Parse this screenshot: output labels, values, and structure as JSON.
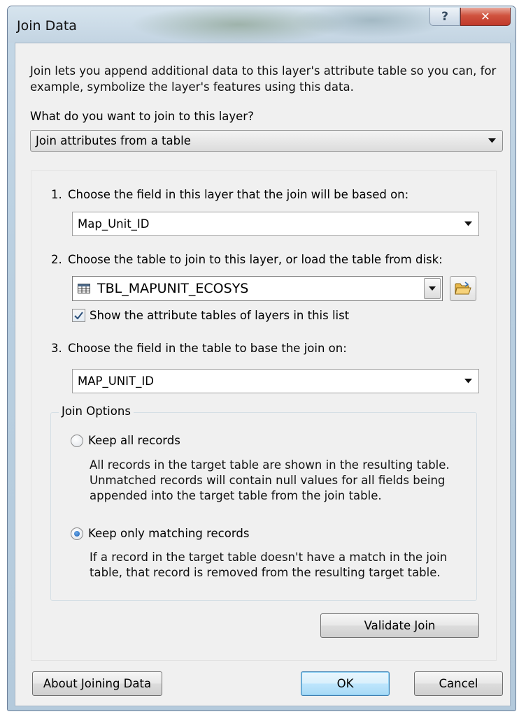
{
  "window": {
    "title": "Join Data",
    "help_glyph": "?",
    "close_glyph": "✕"
  },
  "intro": {
    "text": "Join lets you append additional data to this layer's attribute table so you can, for example, symbolize the layer's features using this data."
  },
  "join_type": {
    "question": "What do you want to join to this layer?",
    "selected": "Join attributes from a table"
  },
  "steps": {
    "step1": {
      "number": "1.",
      "label": "Choose the field in this layer that the join will be based on:",
      "selected": "Map_Unit_ID"
    },
    "step2": {
      "number": "2.",
      "label": "Choose the table to join to this layer, or load the table from disk:",
      "selected": "TBL_MAPUNIT_ECOSYS",
      "show_tables_label": "Show the attribute tables of layers in this list",
      "show_tables_checked": true
    },
    "step3": {
      "number": "3.",
      "label": "Choose the field in the table to base the join on:",
      "selected": "MAP_UNIT_ID"
    }
  },
  "join_options": {
    "legend": "Join Options",
    "keep_all": {
      "label": "Keep all records",
      "description": "All records in the target table are shown in the resulting table. Unmatched records will contain null values for all fields being appended into the target table from the join table.",
      "selected": false
    },
    "keep_matching": {
      "label": "Keep only matching records",
      "description": "If a record in the target table doesn't have a match in the join table, that record is removed from the resulting target table.",
      "selected": true
    }
  },
  "buttons": {
    "validate": "Validate Join",
    "about": "About Joining Data",
    "ok": "OK",
    "cancel": "Cancel"
  },
  "icons": {
    "table": "table-icon",
    "folder": "open-folder-icon",
    "dropdown": "chevron-down-icon",
    "checkmark": "checkmark-icon"
  },
  "colors": {
    "accent": "#3c7fb1",
    "close_red": "#c0392b",
    "radio_blue": "#1a5fb4"
  }
}
